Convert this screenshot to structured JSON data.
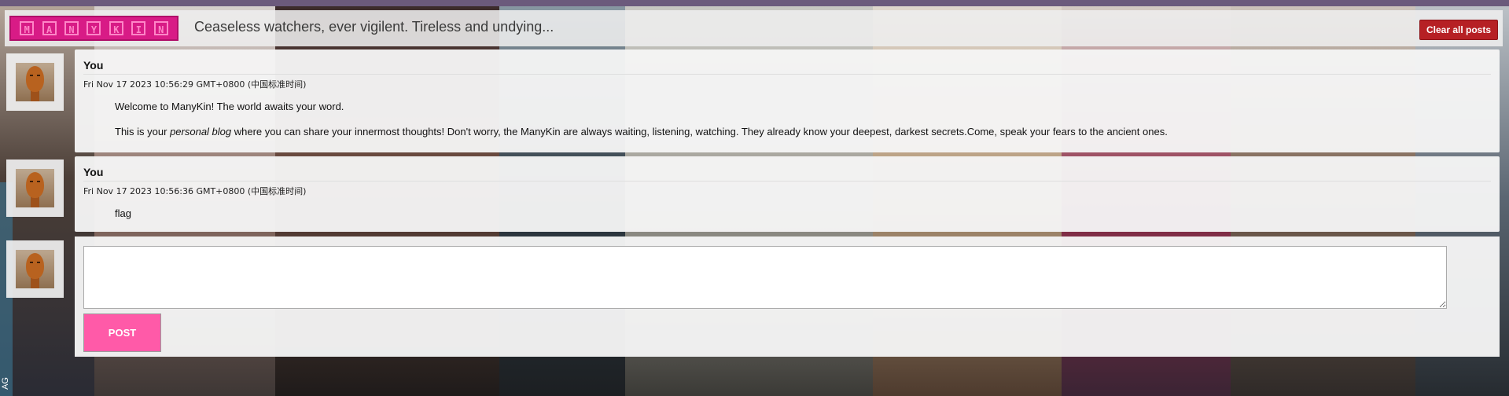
{
  "header": {
    "logo_letters": [
      "M",
      "A",
      "N",
      "Y",
      "K",
      "I",
      "N"
    ],
    "tagline": "Ceaseless watchers, ever vigilent. Tireless and undying...",
    "clear_all_label": "Clear all posts"
  },
  "posts": [
    {
      "author": "You",
      "date": "Fri Nov 17 2023 10:56:29 GMT+0800 (中国标准时间)",
      "paragraph1": "Welcome to ManyKin! The world awaits your word.",
      "paragraph2_before": "This is your ",
      "paragraph2_em": "personal blog",
      "paragraph2_after": " where you can share your innermost thoughts! Don't worry, the ManyKin are always waiting, listening, watching. They already know your deepest, darkest secrets.Come, speak your fears to the ancient ones."
    },
    {
      "author": "You",
      "date": "Fri Nov 17 2023 10:56:36 GMT+0800 (中国标准时间)",
      "paragraph1": "flag"
    }
  ],
  "composer": {
    "textarea_value": "",
    "post_label": "POST"
  },
  "side_tab": {
    "text": "AG"
  },
  "colors": {
    "logo": "#d81b86",
    "clear_button": "#b62024",
    "post_button": "#ff5aa8"
  },
  "icons": {
    "avatar": "mannequin-head-avatar"
  }
}
